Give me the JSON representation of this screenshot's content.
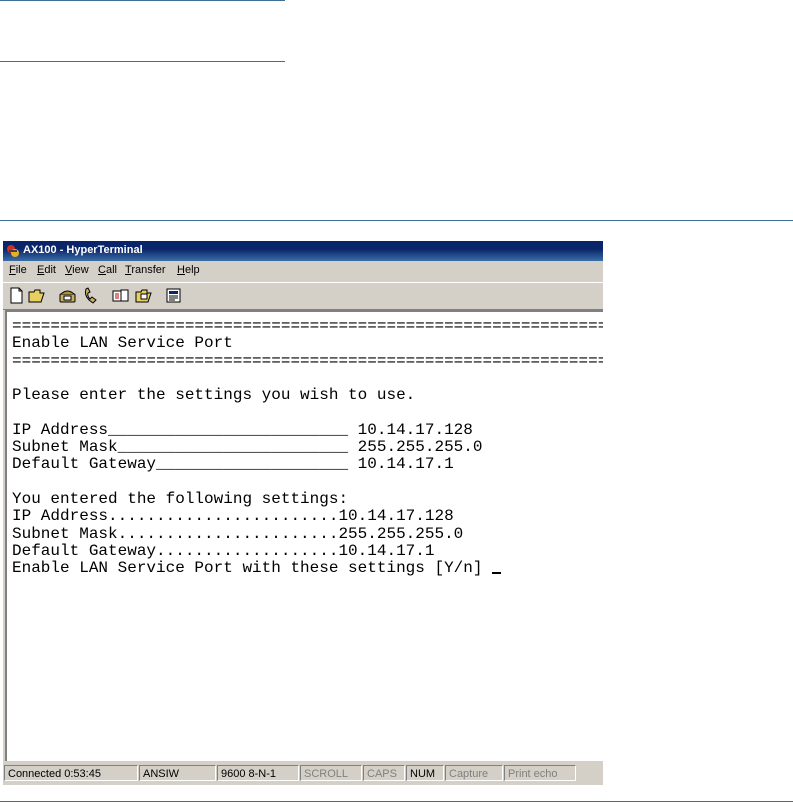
{
  "window": {
    "title": "AX100 - HyperTerminal"
  },
  "menu": [
    "File",
    "Edit",
    "View",
    "Call",
    "Transfer",
    "Help"
  ],
  "toolbar": {
    "buttons": [
      "new-icon",
      "open-icon",
      "phone-icon",
      "disconnect-icon",
      "send-icon",
      "receive-icon",
      "properties-icon"
    ]
  },
  "terminal": {
    "lines": [
      "========================================================================",
      "Enable LAN Service Port",
      "========================================================================",
      "",
      "Please enter the settings you wish to use.",
      "",
      "IP Address_________________________ 10.14.17.128",
      "Subnet Mask________________________ 255.255.255.0",
      "Default Gateway____________________ 10.14.17.1",
      "",
      "You entered the following settings:",
      "IP Address........................10.14.17.128",
      "Subnet Mask.......................255.255.255.0",
      "Default Gateway...................10.14.17.1",
      "Enable LAN Service Port with these settings [Y/n]"
    ]
  },
  "status": {
    "connected": "Connected 0:53:45",
    "emulation": "ANSIW",
    "port_settings": "9600 8-N-1",
    "scroll": "SCROLL",
    "caps": "CAPS",
    "num": "NUM",
    "capture": "Capture",
    "print_echo": "Print echo"
  }
}
